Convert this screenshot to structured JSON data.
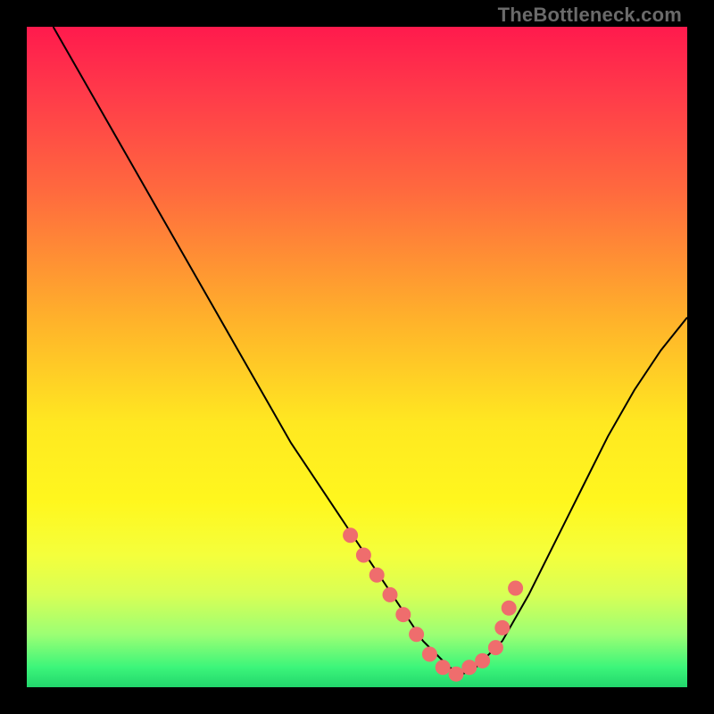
{
  "watermark": "TheBottleneck.com",
  "chart_data": {
    "type": "line",
    "title": "",
    "xlabel": "",
    "ylabel": "",
    "xlim": [
      0,
      100
    ],
    "ylim": [
      0,
      100
    ],
    "grid": false,
    "legend": false,
    "series": [
      {
        "name": "bottleneck-curve",
        "x": [
          4,
          8,
          12,
          16,
          20,
          24,
          28,
          32,
          36,
          40,
          44,
          48,
          52,
          56,
          58,
          60,
          62,
          64,
          66,
          68,
          72,
          76,
          80,
          84,
          88,
          92,
          96,
          100
        ],
        "y": [
          100,
          93,
          86,
          79,
          72,
          65,
          58,
          51,
          44,
          37,
          31,
          25,
          19,
          13,
          10,
          7,
          5,
          3,
          2,
          3,
          7,
          14,
          22,
          30,
          38,
          45,
          51,
          56
        ]
      }
    ],
    "optimal_points": {
      "name": "optimal-range",
      "x": [
        49,
        51,
        53,
        55,
        57,
        59,
        61,
        63,
        65,
        67,
        69,
        71,
        72,
        73,
        74
      ],
      "y": [
        23,
        20,
        17,
        14,
        11,
        8,
        5,
        3,
        2,
        3,
        4,
        6,
        9,
        12,
        15
      ]
    },
    "background_gradient": {
      "top": "#ff1a4d",
      "mid": "#ffe821",
      "bottom": "#22d66c"
    }
  }
}
